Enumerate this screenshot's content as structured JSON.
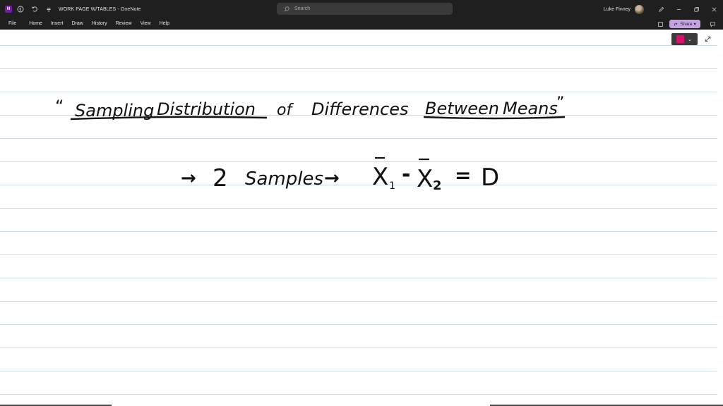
{
  "titlebar": {
    "app_icon_label": "N",
    "document_title": "WORK PAGE W/TABLES - OneNote",
    "search_placeholder": "Search",
    "user_name": "Luke Finney"
  },
  "menu": {
    "items": [
      "File",
      "Home",
      "Insert",
      "Draw",
      "History",
      "Review",
      "View",
      "Help"
    ],
    "share_label": "Share"
  },
  "pen": {
    "color": "#d1166a"
  },
  "notes": {
    "title_open_quote": "“",
    "title_words": [
      "Sampling",
      "Distribution",
      "of",
      "Differences",
      "Between",
      "Means"
    ],
    "title_close_quote": "”",
    "line2_bullet1": "→",
    "line2_count": "2",
    "line2_samples": "Samples",
    "line2_bullet2": "→",
    "line2_x1": "X",
    "line2_sub1": "1",
    "line2_minus": "-",
    "line2_x2": "X",
    "line2_sub2": "2",
    "line2_equals": "=",
    "line2_result": "D"
  },
  "icons": {
    "undo": "undo-icon",
    "redo": "redo-icon",
    "customize": "customize-icon",
    "search": "search-icon",
    "pen": "pen-icon",
    "minimize": "minimize-icon",
    "restore": "restore-icon",
    "close": "close-icon",
    "notebook": "notebook-icon",
    "sticky": "sticky-note-icon",
    "expand": "expand-icon"
  }
}
